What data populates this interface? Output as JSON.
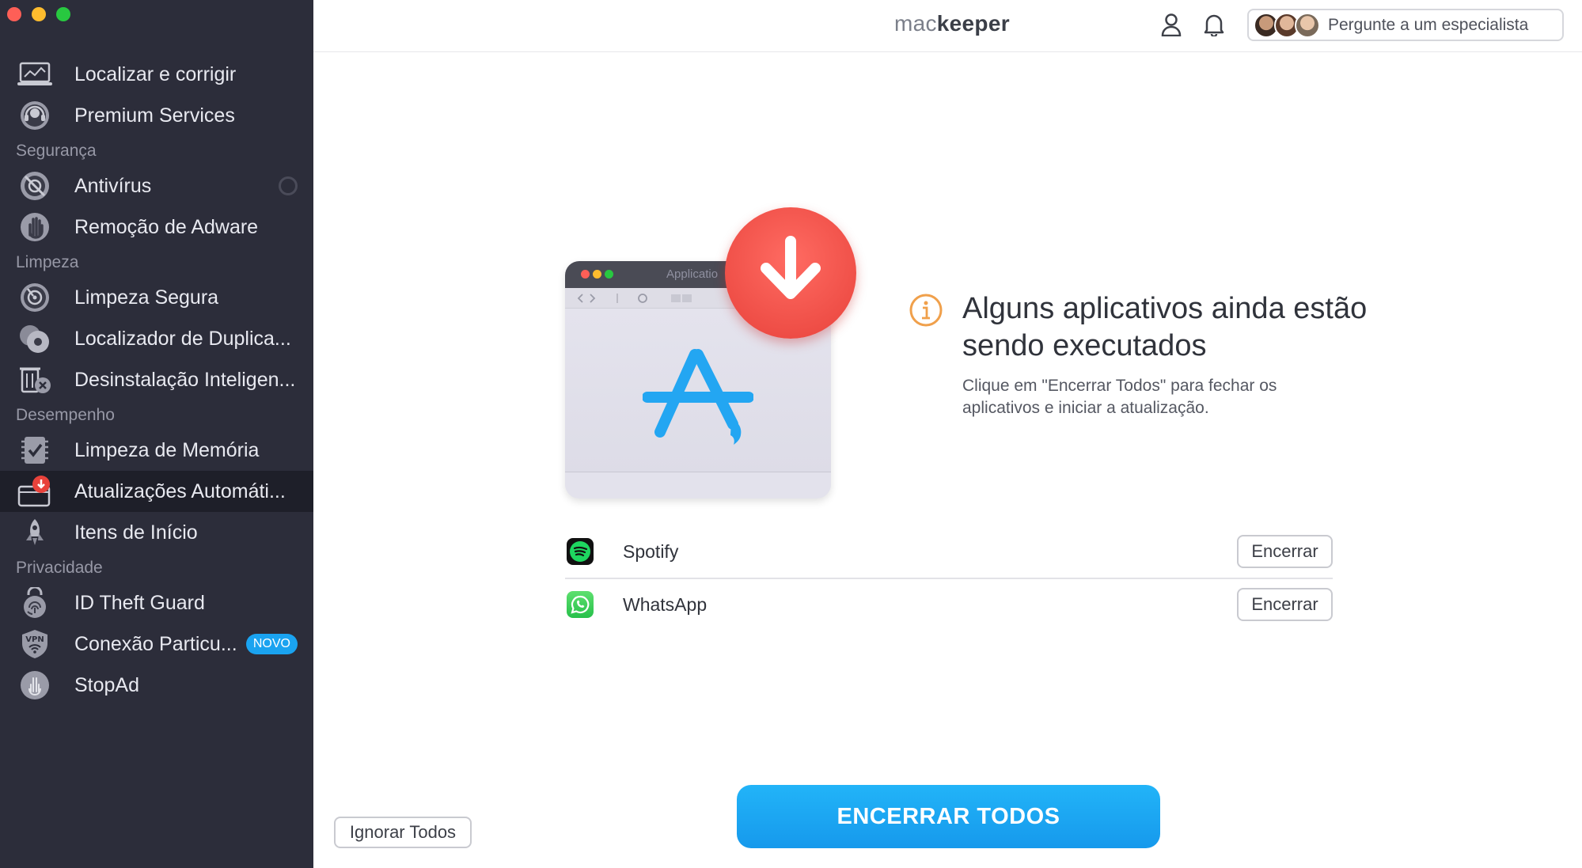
{
  "window": {
    "controls": [
      "close",
      "minimize",
      "zoom"
    ]
  },
  "sidebar": {
    "groups": [
      {
        "section": "",
        "items": [
          {
            "label": "Localizar e corrigir",
            "icon": "laptop-icon"
          },
          {
            "label": "Premium Services",
            "icon": "headset-icon"
          }
        ]
      },
      {
        "section": "Segurança",
        "items": [
          {
            "label": "Antivírus",
            "icon": "antivirus-icon",
            "toggle": true
          },
          {
            "label": "Remoção de Adware",
            "icon": "hand-icon"
          }
        ]
      },
      {
        "section": "Limpeza",
        "items": [
          {
            "label": "Limpeza Segura",
            "icon": "disk-icon"
          },
          {
            "label": "Localizador de Duplica...",
            "icon": "duplicates-icon"
          },
          {
            "label": "Desinstalação Inteligen...",
            "icon": "uninstall-icon"
          }
        ]
      },
      {
        "section": "Desempenho",
        "items": [
          {
            "label": "Limpeza de Memória",
            "icon": "memory-icon"
          },
          {
            "label": "Atualizações Automáti...",
            "icon": "update-icon",
            "active": true
          },
          {
            "label": "Itens de Início",
            "icon": "rocket-icon"
          }
        ]
      },
      {
        "section": "Privacidade",
        "items": [
          {
            "label": "ID Theft Guard",
            "icon": "fingerprint-icon"
          },
          {
            "label": "Conexão Particu...",
            "icon": "vpn-icon",
            "badge": "NOVO"
          },
          {
            "label": "StopAd",
            "icon": "stopad-icon"
          }
        ]
      }
    ]
  },
  "topbar": {
    "logo_light": "mac",
    "logo_bold": "keeper",
    "expert_label": "Pergunte a um especialista"
  },
  "illustration": {
    "window_title": "Applicatio"
  },
  "message": {
    "title": "Alguns aplicativos ainda estão sendo executados",
    "subtitle": "Clique em \"Encerrar Todos\" para fechar os aplicativos e iniciar a atualização."
  },
  "apps": [
    {
      "name": "Spotify",
      "action": "Encerrar",
      "icon": "spotify-icon"
    },
    {
      "name": "WhatsApp",
      "action": "Encerrar",
      "icon": "whatsapp-icon"
    }
  ],
  "footer": {
    "ignore_label": "Ignorar Todos",
    "end_all_label": "ENCERRAR TODOS"
  },
  "colors": {
    "sidebar_bg": "#2c2d3a",
    "sidebar_active": "#1e1f29",
    "accent_blue": "#1aa3f0",
    "alert_red": "#e8423b",
    "info_orange": "#f0a04b"
  }
}
